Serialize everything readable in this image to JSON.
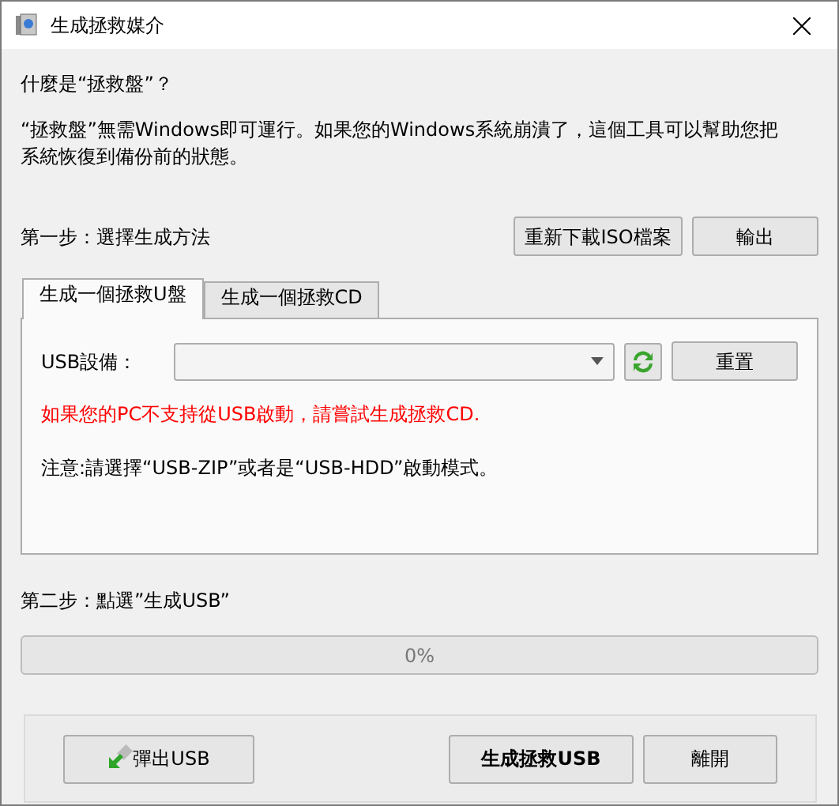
{
  "window": {
    "title": "生成拯救媒介"
  },
  "intro": {
    "heading": "什麼是“拯救盤”？",
    "text": "“拯救盤”無需Windows即可運行。如果您的Windows系統崩潰了，這個工具可以幫助您把系統恢復到備份前的狀態。"
  },
  "step1": {
    "label": "第一步：選擇生成方法",
    "buttons": [
      "重新下載ISO檔案",
      "輸出"
    ]
  },
  "tabs": [
    {
      "label": "生成一個拯救U盤",
      "selected": true
    },
    {
      "label": "生成一個拯救CD",
      "selected": false
    }
  ],
  "usb_panel": {
    "device_label": "USB設備：",
    "reset_button": "重置",
    "warning": "如果您的PC不支持從USB啟動，請嘗試生成拯救CD.",
    "note": "注意:請選擇“USB-ZIP”或者是“USB-HDD”啟動模式。"
  },
  "step2": {
    "label": "第二步：點選”生成USB”"
  },
  "progress": {
    "level": 0,
    "reading": "0%"
  },
  "footer_buttons": [
    {
      "label": "彈出USB",
      "kind": "eject",
      "default": false
    },
    {
      "label": "生成拯救USB",
      "kind": "plain",
      "default": true
    },
    {
      "label": "離開",
      "kind": "plain",
      "default": false
    }
  ]
}
